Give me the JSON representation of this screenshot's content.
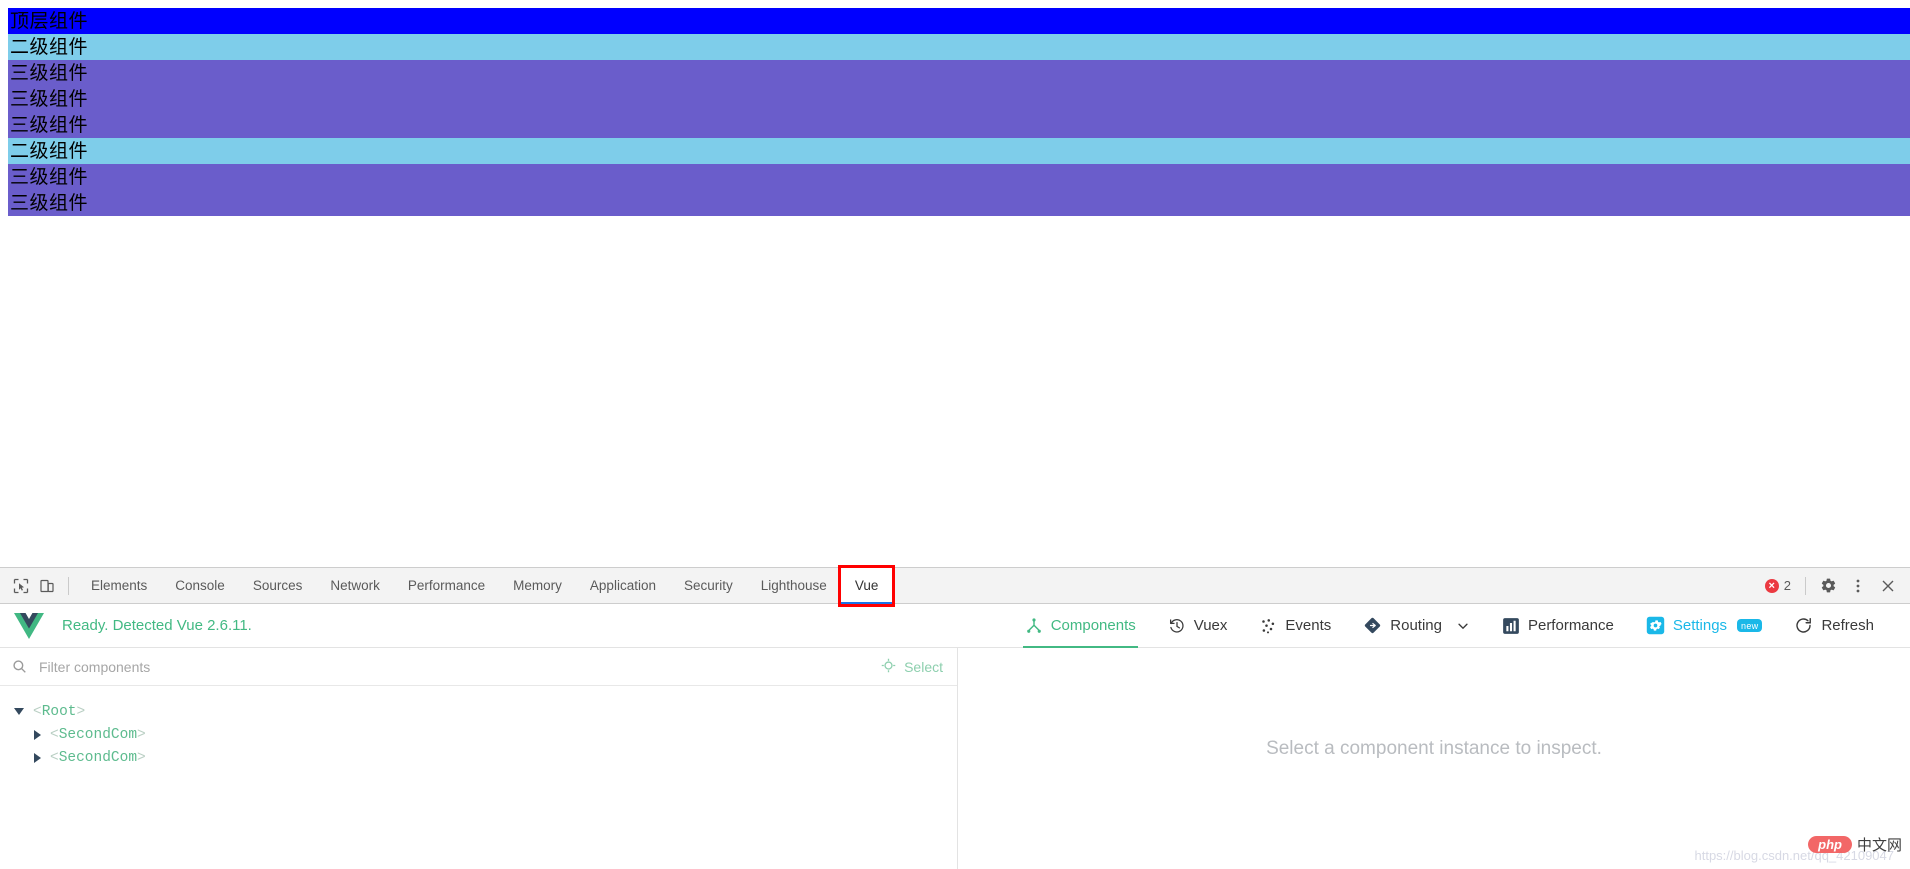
{
  "page": {
    "components": [
      {
        "label": "顶层组件",
        "level": 1
      },
      {
        "label": "二级组件",
        "level": 2
      },
      {
        "label": "三级组件",
        "level": 3
      },
      {
        "label": "三级组件",
        "level": 3
      },
      {
        "label": "三级组件",
        "level": 3
      },
      {
        "label": "二级组件",
        "level": 2
      },
      {
        "label": "三级组件",
        "level": 3
      },
      {
        "label": "三级组件",
        "level": 3
      }
    ],
    "colors": {
      "level1": "#0000ff",
      "level2": "#7ecdea",
      "level3": "#6a5dcb"
    }
  },
  "devtools": {
    "tabs": [
      {
        "label": "Elements",
        "active": false
      },
      {
        "label": "Console",
        "active": false
      },
      {
        "label": "Sources",
        "active": false
      },
      {
        "label": "Network",
        "active": false
      },
      {
        "label": "Performance",
        "active": false
      },
      {
        "label": "Memory",
        "active": false
      },
      {
        "label": "Application",
        "active": false
      },
      {
        "label": "Security",
        "active": false
      },
      {
        "label": "Lighthouse",
        "active": false
      },
      {
        "label": "Vue",
        "active": true,
        "highlighted": true
      }
    ],
    "error_count": "2",
    "highlight_color": "#ff0000",
    "active_tab_underline": "#1a73e8"
  },
  "vue": {
    "status": "Ready. Detected Vue 2.6.11.",
    "status_color": "#42b983",
    "nav": [
      {
        "label": "Components",
        "icon": "components-icon",
        "active": true
      },
      {
        "label": "Vuex",
        "icon": "history-icon",
        "active": false
      },
      {
        "label": "Events",
        "icon": "events-dots-icon",
        "active": false
      },
      {
        "label": "Routing",
        "icon": "routing-diamond-icon",
        "active": false,
        "chevron": true
      },
      {
        "label": "Performance",
        "icon": "bar-chart-icon",
        "active": false
      },
      {
        "label": "Settings",
        "icon": "gear-icon",
        "active": false,
        "badge": "new"
      },
      {
        "label": "Refresh",
        "icon": "refresh-icon",
        "active": false
      }
    ],
    "filter": {
      "placeholder": "Filter components",
      "value": ""
    },
    "select_button": "Select",
    "tree": [
      {
        "name": "Root",
        "depth": 0,
        "expanded": true
      },
      {
        "name": "SecondCom",
        "depth": 1,
        "expanded": false
      },
      {
        "name": "SecondCom",
        "depth": 1,
        "expanded": false
      }
    ],
    "detail_placeholder": "Select a component instance to inspect."
  },
  "watermark": {
    "logo_text": "php",
    "logo_cn": "中文网",
    "url": "https://blog.csdn.net/qq_42109047"
  }
}
